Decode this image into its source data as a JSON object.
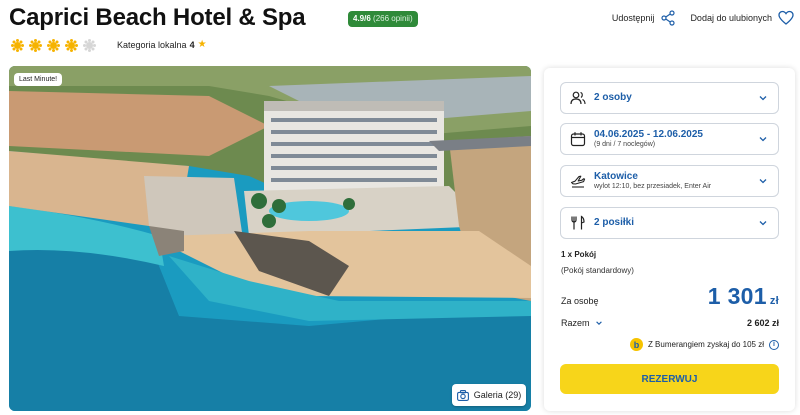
{
  "hotel": {
    "name": "Caprici Beach Hotel & Spa",
    "rating_score": "4.9/6",
    "rating_reviews": "(266 opinii)",
    "stars_total": 5,
    "stars_filled": 4,
    "category_label": "Kategoria lokalna",
    "category_value": "4"
  },
  "actions": {
    "share_label": "Udostępnij",
    "favorite_label": "Dodaj do ulubionych"
  },
  "photo": {
    "badge": "Last Minute!",
    "gallery_label": "Galeria (29)"
  },
  "booking": {
    "guests": "2 osoby",
    "dates": "04.06.2025 - 12.06.2025",
    "dates_sub": "(9 dni / 7 noclegów)",
    "departure_city": "Katowice",
    "departure_sub": "wylot 12:10, bez przesiadek, Enter Air",
    "meals": "2 posiłki",
    "room_count": "1 x Pokój",
    "room_type": "(Pokój standardowy)",
    "per_person_label": "Za osobę",
    "price": "1 301",
    "currency": "zł",
    "total_label": "Razem",
    "total_value": "2 602 zł",
    "bumerang_text": "Z Bumerangiem zyskaj do 105 zł",
    "reserve_label": "REZERWUJ"
  },
  "colors": {
    "accent_blue": "#1d5ea8",
    "rating_green": "#2f8a39",
    "star_yellow": "#f6b300",
    "button_yellow": "#f7d51a"
  }
}
